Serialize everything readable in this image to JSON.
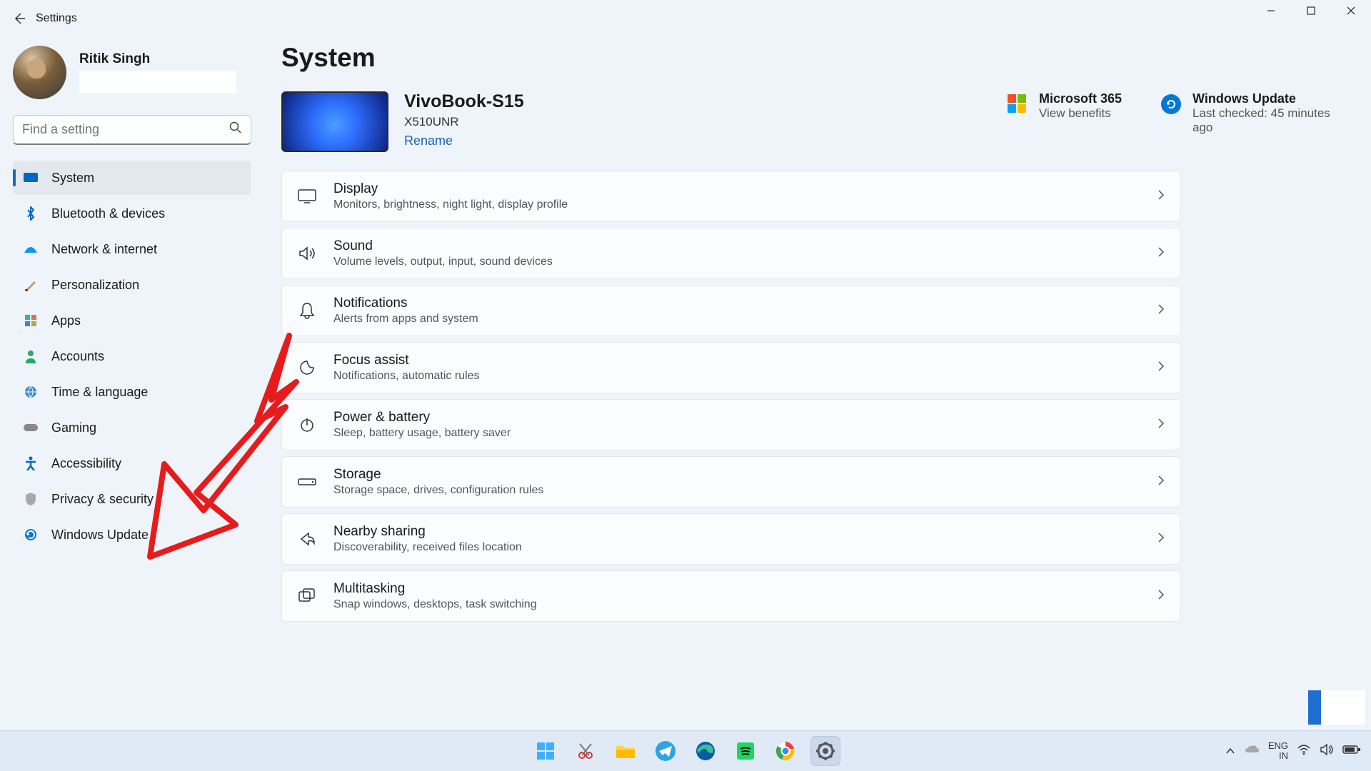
{
  "titlebar": {
    "title": "Settings"
  },
  "user": {
    "name": "Ritik Singh"
  },
  "search": {
    "placeholder": "Find a setting"
  },
  "sidebar": {
    "items": [
      {
        "label": "System",
        "active": true
      },
      {
        "label": "Bluetooth & devices"
      },
      {
        "label": "Network & internet"
      },
      {
        "label": "Personalization"
      },
      {
        "label": "Apps"
      },
      {
        "label": "Accounts"
      },
      {
        "label": "Time & language"
      },
      {
        "label": "Gaming"
      },
      {
        "label": "Accessibility"
      },
      {
        "label": "Privacy & security"
      },
      {
        "label": "Windows Update"
      }
    ]
  },
  "page": {
    "title": "System"
  },
  "device": {
    "name": "VivoBook-S15",
    "model": "X510UNR",
    "rename": "Rename"
  },
  "status": {
    "ms365": {
      "title": "Microsoft 365",
      "sub": "View benefits"
    },
    "wu": {
      "title": "Windows Update",
      "sub": "Last checked: 45 minutes ago"
    }
  },
  "cards": [
    {
      "title": "Display",
      "sub": "Monitors, brightness, night light, display profile"
    },
    {
      "title": "Sound",
      "sub": "Volume levels, output, input, sound devices"
    },
    {
      "title": "Notifications",
      "sub": "Alerts from apps and system"
    },
    {
      "title": "Focus assist",
      "sub": "Notifications, automatic rules"
    },
    {
      "title": "Power & battery",
      "sub": "Sleep, battery usage, battery saver"
    },
    {
      "title": "Storage",
      "sub": "Storage space, drives, configuration rules"
    },
    {
      "title": "Nearby sharing",
      "sub": "Discoverability, received files location"
    },
    {
      "title": "Multitasking",
      "sub": "Snap windows, desktops, task switching"
    }
  ],
  "tray": {
    "lang1": "ENG",
    "lang2": "IN"
  }
}
